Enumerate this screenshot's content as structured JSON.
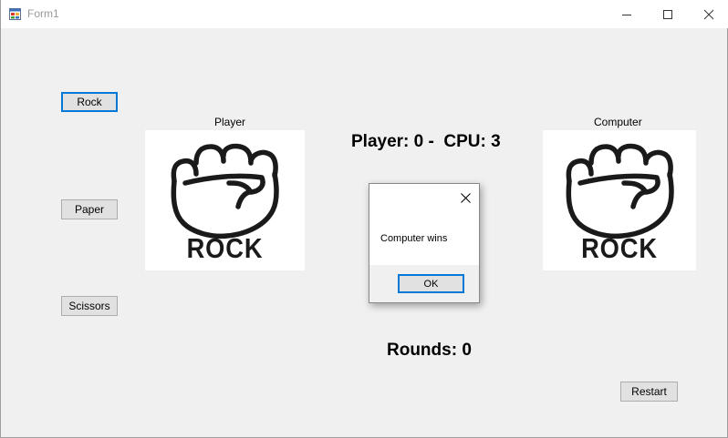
{
  "window": {
    "title": "Form1"
  },
  "buttons": {
    "rock": "Rock",
    "paper": "Paper",
    "scissors": "Scissors",
    "restart": "Restart"
  },
  "labels": {
    "player": "Player",
    "computer": "Computer",
    "score": "Player: 0 -  CPU: 3",
    "rounds": "Rounds: 0"
  },
  "pictures": {
    "player_choice_text": "ROCK",
    "computer_choice_text": "ROCK",
    "icon": "fist-icon"
  },
  "dialog": {
    "message": "Computer wins",
    "ok_label": "OK"
  },
  "colors": {
    "accent": "#0078d7",
    "form_background": "#f0f0f0"
  }
}
